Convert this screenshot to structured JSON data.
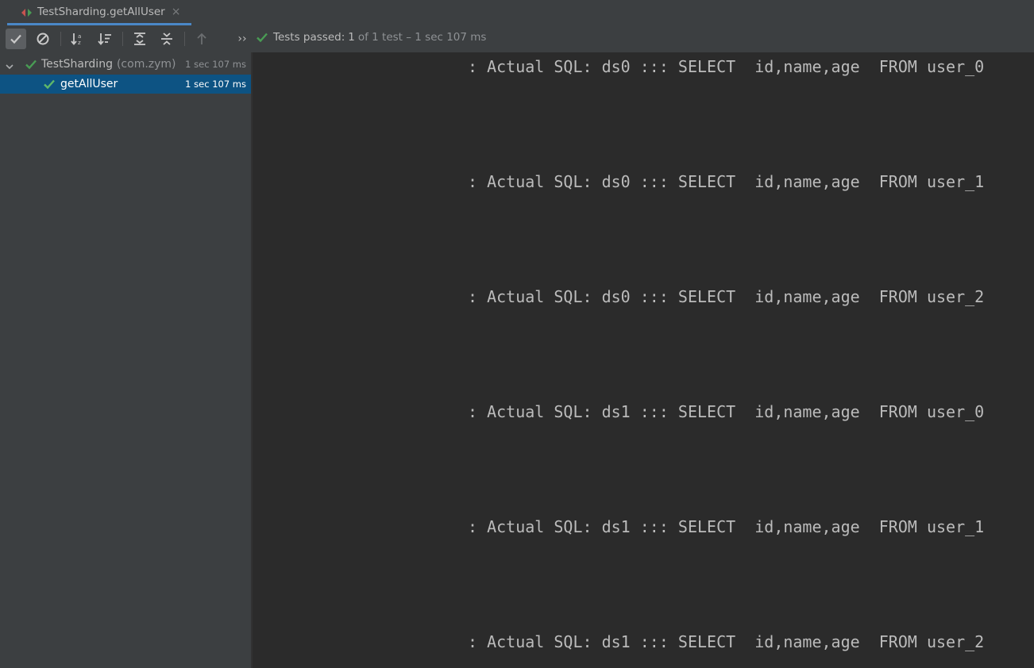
{
  "window": {
    "tab_title": "TestSharding.getAllUser",
    "tab_close": "×"
  },
  "toolbar": {
    "buttons": [
      {
        "name": "show-passed",
        "icon": "checkmark-icon",
        "active": true
      },
      {
        "name": "show-ignored",
        "icon": "cancel-circle-icon",
        "active": false
      },
      {
        "name": "sort-alphabetically",
        "icon": "sort-alpha-icon",
        "active": false
      },
      {
        "name": "sort-by-duration",
        "icon": "sort-duration-icon",
        "active": false
      },
      {
        "name": "expand-all",
        "icon": "expand-all-icon",
        "active": false
      },
      {
        "name": "collapse-all",
        "icon": "collapse-all-icon",
        "active": false
      },
      {
        "name": "previous-failed",
        "icon": "arrow-up-icon",
        "active": false
      },
      {
        "name": "more",
        "icon": "double-chevron-right-icon",
        "active": false
      }
    ],
    "more_label": "››"
  },
  "status": {
    "text": "Tests passed:",
    "count": "1",
    "rest": "of 1 test – 1 sec 107 ms"
  },
  "tree": {
    "root": {
      "name": "TestSharding",
      "package": "(com.zym)",
      "time": "1 sec 107 ms",
      "expanded": true
    },
    "children": [
      {
        "name": "getAllUser",
        "time": "1 sec 107 ms",
        "selected": true
      }
    ]
  },
  "console": {
    "lines": [
      ": Actual SQL: ds0 ::: SELECT  id,name,age  FROM user_0",
      ": Actual SQL: ds0 ::: SELECT  id,name,age  FROM user_1",
      ": Actual SQL: ds0 ::: SELECT  id,name,age  FROM user_2",
      ": Actual SQL: ds1 ::: SELECT  id,name,age  FROM user_0",
      ": Actual SQL: ds1 ::: SELECT  id,name,age  FROM user_1",
      ": Actual SQL: ds1 ::: SELECT  id,name,age  FROM user_2"
    ]
  },
  "colors": {
    "pass_green": "#499c54",
    "selection": "#0d5383",
    "accent": "#4a88c7"
  }
}
